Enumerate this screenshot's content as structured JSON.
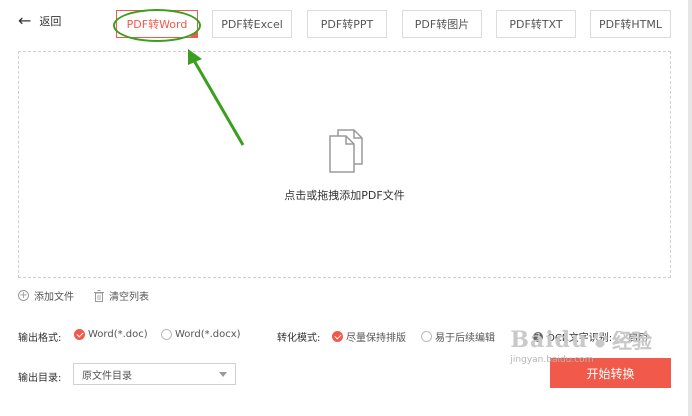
{
  "header": {
    "back_label": "返回",
    "tabs": [
      {
        "label": "PDF转Word",
        "active": true
      },
      {
        "label": "PDF转Excel",
        "active": false
      },
      {
        "label": "PDF转PPT",
        "active": false
      },
      {
        "label": "PDF转图片",
        "active": false
      },
      {
        "label": "PDF转TXT",
        "active": false
      },
      {
        "label": "PDF转HTML",
        "active": false
      }
    ]
  },
  "dropzone": {
    "icon": "document-stack-icon",
    "text": "点击或拖拽添加PDF文件"
  },
  "file_actions": {
    "add_label": "添加文件",
    "clear_label": "清空列表"
  },
  "output_format": {
    "label": "输出格式:",
    "options": [
      {
        "label": "Word(*.doc)",
        "checked": true
      },
      {
        "label": "Word(*.docx)",
        "checked": false
      }
    ]
  },
  "convert_mode": {
    "label": "转化模式:",
    "options": [
      {
        "label": "尽量保持排版",
        "checked": true
      },
      {
        "label": "易于后续编辑",
        "checked": false
      }
    ]
  },
  "ocr": {
    "label": "OCR文字识别:",
    "option_label": "启用",
    "checked": false
  },
  "output_dir": {
    "label": "输出目录:",
    "selected": "原文件目录"
  },
  "start_button": {
    "label": "开始转换"
  },
  "watermark": {
    "brand": "Baidu",
    "suffix": "经验",
    "url": "jingyan.baidu.com"
  },
  "colors": {
    "accent": "#f15a4a",
    "annotation": "#3a9f1f",
    "border": "#dcdcdc"
  }
}
